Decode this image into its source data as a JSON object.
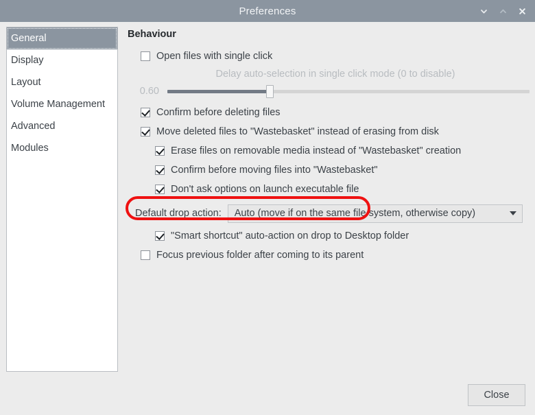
{
  "window": {
    "title": "Preferences",
    "buttons": [
      {
        "name": "minimize",
        "glyph": "chevron-down"
      },
      {
        "name": "maximize",
        "glyph": "chevron-up"
      },
      {
        "name": "close",
        "glyph": "x"
      }
    ]
  },
  "sidebar": {
    "items": [
      {
        "label": "General",
        "selected": true
      },
      {
        "label": "Display",
        "selected": false
      },
      {
        "label": "Layout",
        "selected": false
      },
      {
        "label": "Volume Management",
        "selected": false
      },
      {
        "label": "Advanced",
        "selected": false
      },
      {
        "label": "Modules",
        "selected": false
      }
    ]
  },
  "main": {
    "group_title": "Behaviour",
    "single_click": {
      "label": "Open files with single click",
      "checked": false
    },
    "delay_slider": {
      "caption": "Delay auto-selection in single click mode (0 to disable)",
      "value": "0.60",
      "enabled": false
    },
    "options": [
      {
        "label": "Confirm before deleting files",
        "checked": true,
        "indent": 0
      },
      {
        "label": "Move deleted files to \"Wastebasket\" instead of erasing from disk",
        "checked": true,
        "indent": 0
      },
      {
        "label": "Erase files on removable media instead of \"Wastebasket\" creation",
        "checked": true,
        "indent": 1
      },
      {
        "label": "Confirm before moving files into \"Wastebasket\"",
        "checked": true,
        "indent": 1
      },
      {
        "label": "Don't ask options on launch executable file",
        "checked": true,
        "indent": 1,
        "highlighted": true
      }
    ],
    "drop_action": {
      "label": "Default drop action:",
      "value": "Auto (move if on the same file system, otherwise copy)"
    },
    "after_options": [
      {
        "label": "\"Smart shortcut\" auto-action on drop to Desktop folder",
        "checked": true,
        "indent": 1
      },
      {
        "label": "Focus previous folder after coming to its parent",
        "checked": false,
        "indent": 0
      }
    ]
  },
  "footer": {
    "close_label": "Close"
  },
  "colors": {
    "titlebar": "#8b95a0",
    "selection": "#8b95a0",
    "background": "#ececec",
    "annotation": "#ef1111",
    "slider_fill": "#727a85"
  }
}
